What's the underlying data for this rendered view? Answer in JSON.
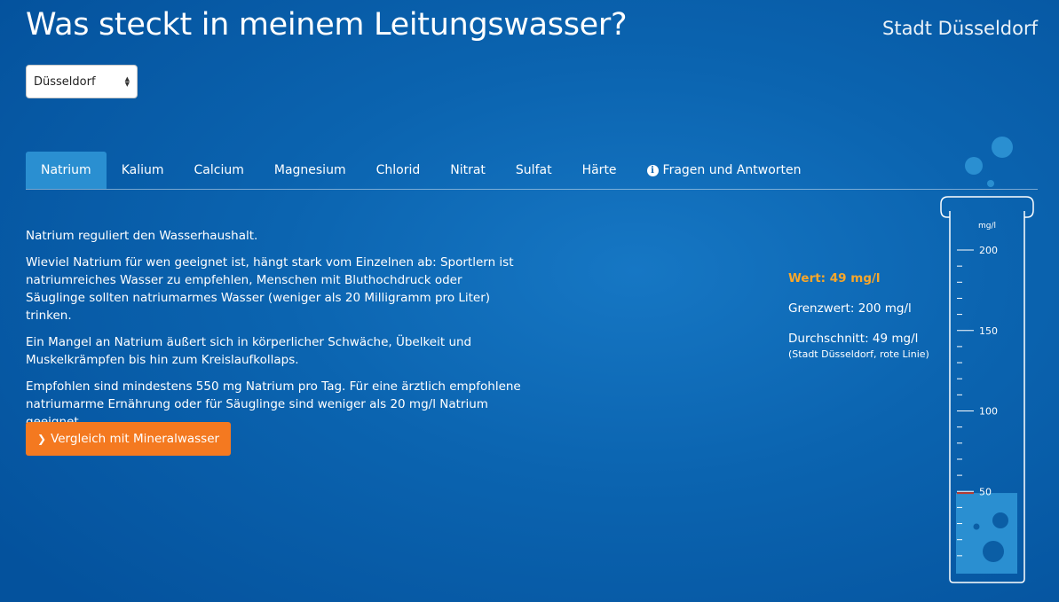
{
  "header": {
    "title": "Was steckt in meinem Leitungswasser?",
    "city": "Stadt Düsseldorf"
  },
  "city_select": {
    "value": "Düsseldorf"
  },
  "tabs": [
    {
      "label": "Natrium",
      "active": true
    },
    {
      "label": "Kalium"
    },
    {
      "label": "Calcium"
    },
    {
      "label": "Magnesium"
    },
    {
      "label": "Chlorid"
    },
    {
      "label": "Nitrat"
    },
    {
      "label": "Sulfat"
    },
    {
      "label": "Härte"
    },
    {
      "label": "Fragen und Antworten",
      "icon": "info-icon"
    }
  ],
  "content": {
    "paragraphs": [
      "Natrium reguliert den Wasserhaushalt.",
      "Wieviel Natrium für wen geeignet ist, hängt stark vom Einzelnen ab: Sportlern ist natriumreiches Wasser zu empfehlen, Menschen mit Bluthochdruck oder Säuglinge sollten natriumarmes Wasser (weniger als 20 Milligramm pro Liter) trinken.",
      "Ein Mangel an Natrium äußert sich in körperlicher Schwäche, Übelkeit und Muskelkrämpfen bis hin zum Kreislaufkollaps.",
      "Empfohlen sind mindestens 550 mg Natrium pro Tag. Für eine ärztlich empfohlene natriumarme Ernährung oder für Säuglinge sind weniger als 20 mg/l Natrium geeignet."
    ],
    "button_label": "Vergleich mit Mineralwasser",
    "button_icon": "chevron-right-icon"
  },
  "values": {
    "current": "Wert: 49 mg/l",
    "limit": "Grenzwert: 200 mg/l",
    "average": "Durchschnitt: 49 mg/l",
    "average_note": "(Stadt Düsseldorf, rote Linie)"
  },
  "tube": {
    "unit": "mg/l",
    "scale_max": 200,
    "scale_min": 0,
    "major_ticks": [
      200,
      150,
      100,
      50
    ],
    "minor_step": 10,
    "fill_value": 49,
    "average_value": 49,
    "colors": {
      "fill": "#2a8fd1",
      "average_line": "#c0392b",
      "outline": "#ffffff"
    }
  },
  "colors": {
    "background": "#0b64b0",
    "accent_orange": "#f47920",
    "value_highlight": "#f9a72a",
    "tab_active": "#2a8fd1"
  }
}
